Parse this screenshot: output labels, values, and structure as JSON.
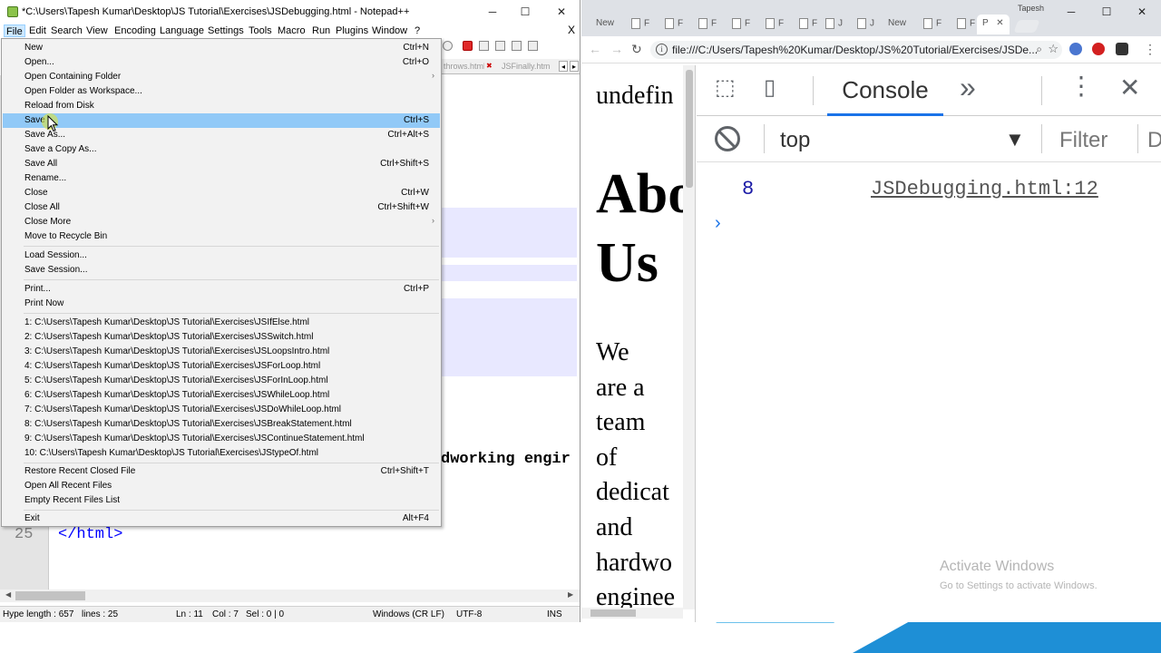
{
  "npp": {
    "title": "*C:\\Users\\Tapesh Kumar\\Desktop\\JS Tutorial\\Exercises\\JSDebugging.html - Notepad++",
    "window_controls": [
      "─",
      "☐",
      "✕"
    ],
    "menu": [
      "File",
      "Edit",
      "Search",
      "View",
      "Encoding",
      "Language",
      "Settings",
      "Tools",
      "Macro",
      "Run",
      "Plugins",
      "Window",
      "?"
    ],
    "menu_close": "X",
    "tabs": [
      "throws.html",
      "JSFinally.htm"
    ],
    "tab_arrows": [
      "◂",
      "▸"
    ],
    "code": {
      "visible_fragment": "dworking engir",
      "line25_num": "25",
      "line25": "</html>"
    },
    "status": {
      "length": "Hype length : 657",
      "lines": "lines : 25",
      "ln": "Ln : 11",
      "col": "Col : 7",
      "sel": "Sel : 0 | 0",
      "eol": "Windows (CR LF)",
      "encoding": "UTF-8",
      "mode": "INS"
    }
  },
  "file_menu": {
    "items": [
      {
        "label": "New",
        "shortcut": "Ctrl+N"
      },
      {
        "label": "Open...",
        "shortcut": "Ctrl+O"
      },
      {
        "label": "Open Containing Folder",
        "shortcut": "",
        "submenu": "›"
      },
      {
        "label": "Open Folder as Workspace...",
        "shortcut": ""
      },
      {
        "label": "Reload from Disk",
        "shortcut": ""
      },
      {
        "label": "Save",
        "shortcut": "Ctrl+S"
      },
      {
        "label": "Save As...",
        "shortcut": "Ctrl+Alt+S"
      },
      {
        "label": "Save a Copy As...",
        "shortcut": ""
      },
      {
        "label": "Save All",
        "shortcut": "Ctrl+Shift+S"
      },
      {
        "label": "Rename...",
        "shortcut": ""
      },
      {
        "label": "Close",
        "shortcut": "Ctrl+W"
      },
      {
        "label": "Close All",
        "shortcut": "Ctrl+Shift+W"
      },
      {
        "label": "Close More",
        "shortcut": "",
        "submenu": "›"
      },
      {
        "label": "Move to Recycle Bin",
        "shortcut": ""
      },
      {
        "label": "Load Session...",
        "shortcut": ""
      },
      {
        "label": "Save Session...",
        "shortcut": ""
      },
      {
        "label": "Print...",
        "shortcut": "Ctrl+P"
      },
      {
        "label": "Print Now",
        "shortcut": ""
      },
      {
        "label": "1: C:\\Users\\Tapesh Kumar\\Desktop\\JS Tutorial\\Exercises\\JSIfElse.html",
        "shortcut": ""
      },
      {
        "label": "2: C:\\Users\\Tapesh Kumar\\Desktop\\JS Tutorial\\Exercises\\JSSwitch.html",
        "shortcut": ""
      },
      {
        "label": "3: C:\\Users\\Tapesh Kumar\\Desktop\\JS Tutorial\\Exercises\\JSLoopsIntro.html",
        "shortcut": ""
      },
      {
        "label": "4: C:\\Users\\Tapesh Kumar\\Desktop\\JS Tutorial\\Exercises\\JSForLoop.html",
        "shortcut": ""
      },
      {
        "label": "5: C:\\Users\\Tapesh Kumar\\Desktop\\JS Tutorial\\Exercises\\JSForInLoop.html",
        "shortcut": ""
      },
      {
        "label": "6: C:\\Users\\Tapesh Kumar\\Desktop\\JS Tutorial\\Exercises\\JSWhileLoop.html",
        "shortcut": ""
      },
      {
        "label": "7: C:\\Users\\Tapesh Kumar\\Desktop\\JS Tutorial\\Exercises\\JSDoWhileLoop.html",
        "shortcut": ""
      },
      {
        "label": "8: C:\\Users\\Tapesh Kumar\\Desktop\\JS Tutorial\\Exercises\\JSBreakStatement.html",
        "shortcut": ""
      },
      {
        "label": "9: C:\\Users\\Tapesh Kumar\\Desktop\\JS Tutorial\\Exercises\\JSContinueStatement.html",
        "shortcut": ""
      },
      {
        "label": "10: C:\\Users\\Tapesh Kumar\\Desktop\\JS Tutorial\\Exercises\\JStypeOf.html",
        "shortcut": ""
      },
      {
        "label": "Restore Recent Closed File",
        "shortcut": "Ctrl+Shift+T"
      },
      {
        "label": "Open All Recent Files",
        "shortcut": ""
      },
      {
        "label": "Empty Recent Files List",
        "shortcut": ""
      },
      {
        "label": "Exit",
        "shortcut": "Alt+F4"
      }
    ],
    "selected": "Save"
  },
  "chrome": {
    "profile": "Tapesh",
    "tabs": [
      "New",
      "F",
      "F",
      "F",
      "F",
      "F",
      "F",
      "J",
      "J",
      "New",
      "F",
      "F",
      "P"
    ],
    "active_tab_close": "✕",
    "window_controls": [
      "─",
      "☐",
      "✕"
    ],
    "url": "file:///C:/Users/Tapesh%20Kumar/Desktop/JS%20Tutorial/Exercises/JSDe...",
    "page": {
      "line1": "undefin",
      "heading_l1": "Abo",
      "heading_l2": "Us",
      "para": [
        "We",
        "are a",
        "team",
        "of",
        "dedicat",
        "and",
        "hardwo",
        "enginee"
      ]
    }
  },
  "devtools": {
    "tab_console": "Console",
    "more_tabs": "»",
    "context": "top",
    "filter_placeholder": "Filter",
    "levels": "De",
    "log_value": "8",
    "log_source": "JSDebugging.html:12",
    "prompt": "›"
  },
  "watermark": {
    "line1": "Activate Windows",
    "line2": "Go to Settings to activate Windows."
  }
}
